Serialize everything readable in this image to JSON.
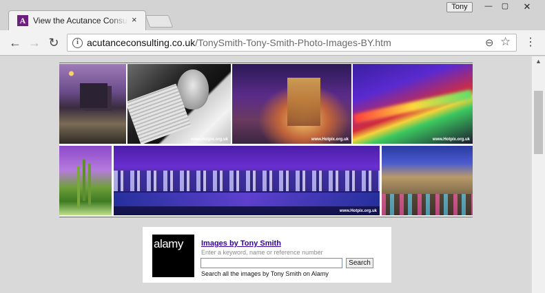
{
  "browser": {
    "tab_title": "View the Acutance Consulta",
    "tab_close": "×",
    "favicon_letter": "A",
    "profile_name": "Tony",
    "window_buttons": {
      "minimize": "—",
      "maximize": "▢",
      "close": "✕"
    }
  },
  "toolbar": {
    "back_glyph": "←",
    "forward_glyph": "→",
    "reload_glyph": "↻",
    "info_glyph": "i",
    "url_host": "acutanceconsulting.co.uk",
    "url_path": "/TonySmith-Tony-Smith-Photo-Images-BY.htm",
    "zoom_glyph": "⊖",
    "star_glyph": "☆",
    "menu_glyph": "⋮"
  },
  "gallery": {
    "watermark": "www.Hotpix.org.uk"
  },
  "alamy": {
    "logo_text": "alamy",
    "link_text": "Images by Tony Smith",
    "hint_text": "Enter a keyword, name or reference number",
    "input_value": "",
    "search_button": "Search",
    "description": "Search all the images by Tony Smith on Alamy"
  },
  "colors": {
    "link": "#330099",
    "favicon": "#6e1e7e"
  }
}
